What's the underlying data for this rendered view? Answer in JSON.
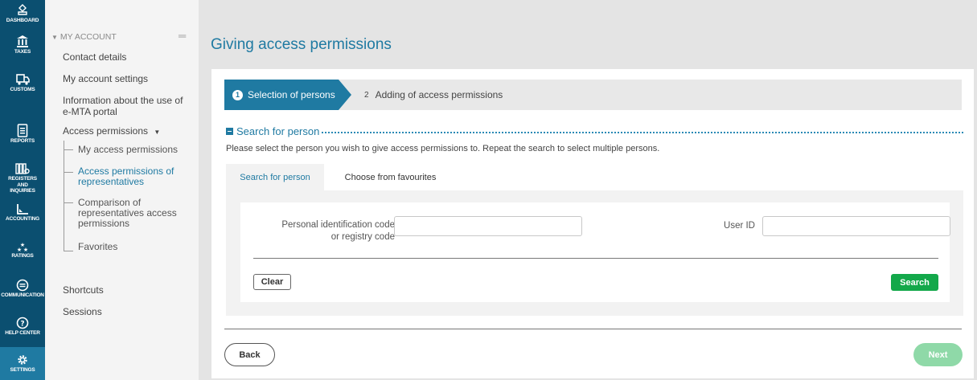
{
  "rail": {
    "items": [
      {
        "label": "DASHBOARD",
        "icon": "dashboard-icon"
      },
      {
        "label": "TAXES",
        "icon": "bank-icon"
      },
      {
        "label": "CUSTOMS",
        "icon": "truck-icon"
      },
      {
        "label": "REPORTS",
        "icon": "document-icon"
      },
      {
        "label": "REGISTERS AND INQUIRIES",
        "icon": "registers-icon"
      },
      {
        "label": "ACCOUNTING",
        "icon": "chart-icon"
      },
      {
        "label": "RATINGS",
        "icon": "stars-icon"
      },
      {
        "label": "COMMUNICATION",
        "icon": "chat-icon"
      },
      {
        "label": "HELP CENTER",
        "icon": "help-icon"
      },
      {
        "label": "SETTINGS",
        "icon": "gear-icon",
        "active": true
      }
    ]
  },
  "sidebar": {
    "section_title": "MY ACCOUNT",
    "links": {
      "contact_details": "Contact details",
      "my_account_settings": "My account settings",
      "emta_info_line1": "Information about the use of",
      "emta_info_line2": "e-MTA portal",
      "access_permissions": "Access permissions",
      "shortcuts": "Shortcuts",
      "sessions": "Sessions"
    },
    "sub_items": {
      "my_access_permissions": "My access permissions",
      "rep_line1": "Access permissions of",
      "rep_line2": "representatives",
      "cmp_line1": "Comparison of",
      "cmp_line2": "representatives access",
      "cmp_line3": "permissions",
      "favorites": "Favorites"
    }
  },
  "main": {
    "title": "Giving access permissions",
    "steps": [
      {
        "num": "1",
        "label": "Selection of persons",
        "active": true
      },
      {
        "num": "2",
        "label": "Adding of access permissions",
        "active": false
      }
    ],
    "section_title": "Search for person",
    "instruction": "Please select the person you wish to give access permissions to. Repeat the search to select multiple persons.",
    "tabs": {
      "search": "Search for person",
      "favourites": "Choose from favourites"
    },
    "form": {
      "code_label_line1": "Personal identification code",
      "code_label_line2": "or registry code",
      "code_value": "",
      "user_id_label": "User ID",
      "user_id_value": "",
      "clear_label": "Clear",
      "search_label": "Search"
    },
    "footer": {
      "back_label": "Back",
      "next_label": "Next"
    }
  },
  "colors": {
    "rail": "#0b4f70",
    "accent": "#1f7aa2",
    "search_button": "#13a84a",
    "next_button_disabled": "#8fd9a8"
  }
}
